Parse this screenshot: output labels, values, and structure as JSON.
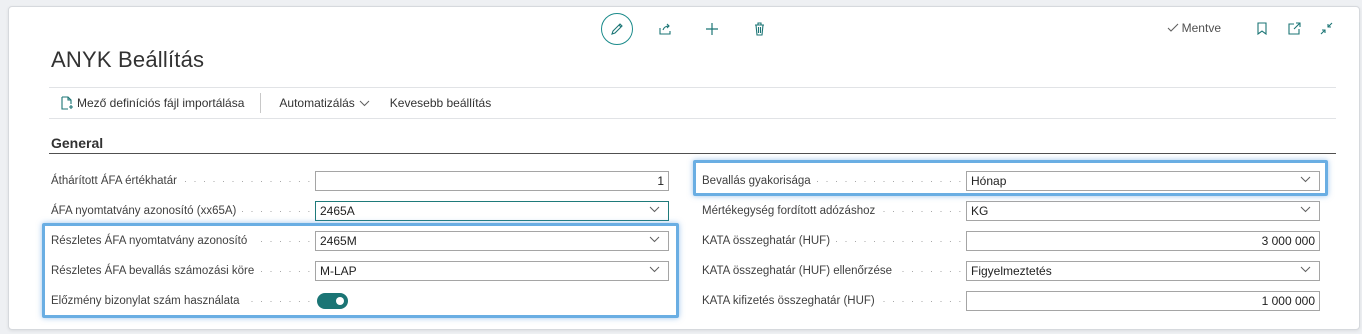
{
  "header": {
    "saved_label": "Mentve",
    "page_title": "ANYK Beállítás"
  },
  "actionbar": {
    "import_label": "Mező definíciós fájl importálása",
    "automation_label": "Automatizálás",
    "less_label": "Kevesebb beállítás"
  },
  "section": {
    "title": "General"
  },
  "left_fields": [
    {
      "label": "Áthárított ÁFA értékhatár",
      "value": "1"
    },
    {
      "label": "ÁFA nyomtatvány azonosító (xx65A)",
      "value": "2465A"
    },
    {
      "label": "Részletes ÁFA nyomtatvány azonosító",
      "value": "2465M"
    },
    {
      "label": "Részletes ÁFA bevallás számozási köre",
      "value": "M-LAP"
    },
    {
      "label": "Előzmény bizonylat szám használata",
      "value_on": true
    }
  ],
  "right_fields": [
    {
      "label": "Bevallás gyakorisága",
      "value": "Hónap"
    },
    {
      "label": "Mértékegység fordított adózáshoz",
      "value": "KG"
    },
    {
      "label": "KATA összeghatár (HUF)",
      "value": "3 000 000"
    },
    {
      "label": "KATA összeghatár (HUF) ellenőrzése",
      "value": "Figyelmeztetés"
    },
    {
      "label": "KATA kifizetés összeghatár (HUF)",
      "value": "1 000 000"
    }
  ],
  "colors": {
    "accent": "#1b7575",
    "highlight": "#6aaee3"
  },
  "icons": [
    "back-arrow-icon",
    "pencil-icon",
    "share-icon",
    "plus-icon",
    "trash-icon",
    "check-icon",
    "bookmark-icon",
    "open-new-icon",
    "collapse-icon",
    "import-file-icon",
    "chevron-down-icon"
  ]
}
